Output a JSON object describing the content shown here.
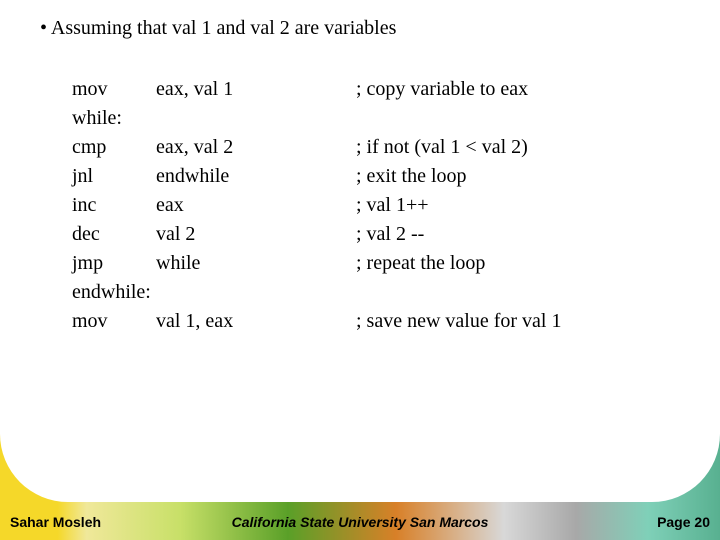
{
  "heading": "• Assuming that val 1 and val 2 are variables",
  "code_rows": [
    {
      "indent": true,
      "c1": "mov",
      "c2": "eax, val 1",
      "c3": "; copy variable to eax"
    },
    {
      "indent": false,
      "c1": "while:",
      "c2": "",
      "c3": ""
    },
    {
      "indent": true,
      "c1": "cmp",
      "c2": "eax, val 2",
      "c3": "; if not (val 1 < val 2)"
    },
    {
      "indent": true,
      "c1": "jnl",
      "c2": "endwhile",
      "c3": "; exit the loop"
    },
    {
      "indent": true,
      "c1": "inc",
      "c2": "eax",
      "c3": "; val 1++"
    },
    {
      "indent": true,
      "c1": "dec",
      "c2": "val 2",
      "c3": "; val 2 --"
    },
    {
      "indent": true,
      "c1": "jmp",
      "c2": "while",
      "c3": "; repeat the loop"
    },
    {
      "indent": false,
      "c1": "endwhile:",
      "c2": "",
      "c3": ""
    },
    {
      "indent": true,
      "c1": "mov",
      "c2": "val 1, eax",
      "c3": "; save new value for val 1"
    }
  ],
  "footer": {
    "left": "Sahar Mosleh",
    "center": "California State University San Marcos",
    "right": "Page 20"
  }
}
